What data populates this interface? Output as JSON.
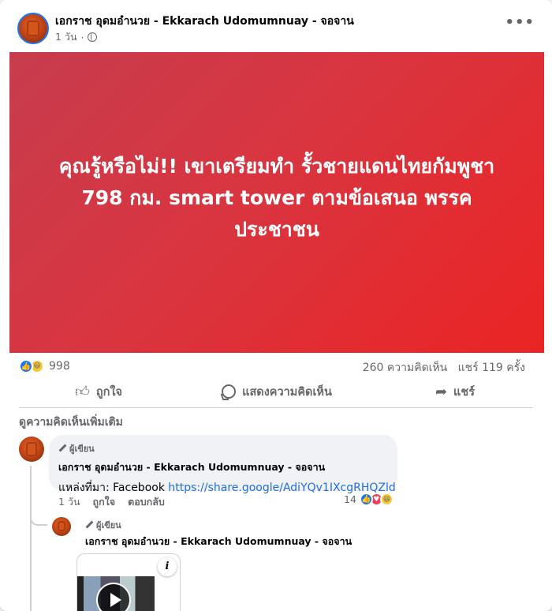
{
  "post": {
    "author": "เอกราช อุดมอำนวย - Ekkarach Udomumnuay - จอจาน",
    "time": "1 วัน",
    "privacy_icon": "globe-icon",
    "more_label": "•••"
  },
  "banner": {
    "text_line1": "คุณรู้หรือไม่!! เขาเตรียมทำ รั้วชายแดนไทยกัมพูชา",
    "text_line2": "798 กม. smart tower ตามข้อเสนอ พรรคประชาชน",
    "gradient_start": "#c73c4d",
    "gradient_end": "#ea2424"
  },
  "stats": {
    "reaction_count": "998",
    "comments": "260 ความคิดเห็น",
    "shares": "แชร์ 119 ครั้ง"
  },
  "actions": {
    "like": "ถูกใจ",
    "comment": "แสดงความคิดเห็น",
    "share": "แชร์"
  },
  "comments_section": {
    "more_comments": "ดูความคิดเห็นเพิ่มเติม"
  },
  "comment1": {
    "badge": "ผู้เขียน",
    "name": "เอกราช อุดมอำนวย - Ekkarach Udomumnuay - จอจาน",
    "text_prefix": "แหล่งที่มา: Facebook ",
    "link": "https://share.google/AdiYQv1IXcgRHQZld",
    "time": "1 วัน",
    "like": "ถูกใจ",
    "reply": "ตอบกลับ",
    "reaction_count": "14"
  },
  "comment2": {
    "badge": "ผู้เขียน",
    "name": "เอกราช อุดมอำนวย - Ekkarach Udomumnuay - จอจาน",
    "info_label": "i"
  },
  "colors": {
    "link": "#216fdb",
    "like_blue": "#1877f2",
    "love_red": "#f33e58",
    "haha_yellow": "#f7c93a"
  }
}
